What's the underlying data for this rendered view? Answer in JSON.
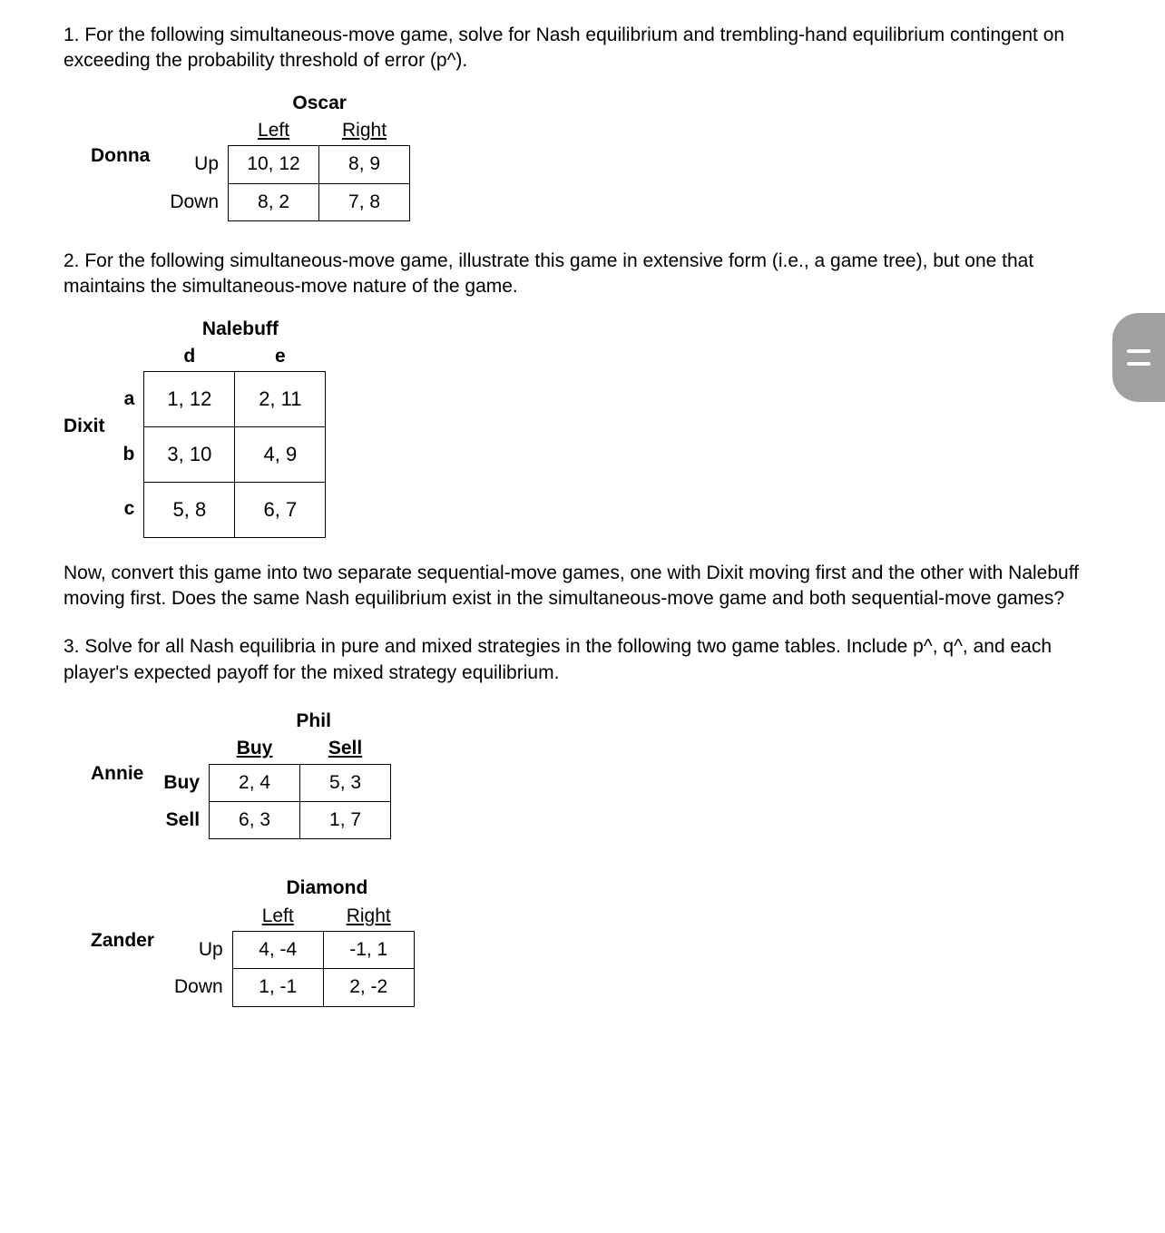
{
  "q1": {
    "text": "1. For the following simultaneous-move game, solve for Nash equilibrium and trembling-hand equilibrium contingent on exceeding the probability threshold of error (p^).",
    "game": {
      "rowPlayer": "Donna",
      "colPlayer": "Oscar",
      "rowLabels": [
        "Up",
        "Down"
      ],
      "colLabels": [
        "Left",
        "Right"
      ],
      "cells": [
        [
          "10, 12",
          "8, 9"
        ],
        [
          "8, 2",
          "7, 8"
        ]
      ]
    }
  },
  "q2": {
    "text": "2. For the following simultaneous-move game, illustrate this game in extensive form (i.e., a game tree), but one that maintains the simultaneous-move nature of the game.",
    "game": {
      "rowPlayer": "Dixit",
      "colPlayer": "Nalebuff",
      "rowLabels": [
        "a",
        "b",
        "c"
      ],
      "colLabels": [
        "d",
        "e"
      ],
      "cells": [
        [
          "1, 12",
          "2, 11"
        ],
        [
          "3, 10",
          "4, 9"
        ],
        [
          "5, 8",
          "6, 7"
        ]
      ]
    },
    "followup": "Now, convert this game into two separate sequential-move games, one with Dixit moving first and the other with Nalebuff moving first. Does the same Nash equilibrium exist in the simultaneous-move game and both sequential-move games?"
  },
  "q3": {
    "text": "3. Solve for all Nash equilibria in pure and mixed strategies in the following two game tables. Include p^, q^, and each player's expected payoff for the mixed strategy equilibrium.",
    "gameA": {
      "rowPlayer": "Annie",
      "colPlayer": "Phil",
      "rowLabels": [
        "Buy",
        "Sell"
      ],
      "colLabels": [
        "Buy",
        "Sell"
      ],
      "cells": [
        [
          "2, 4",
          "5, 3"
        ],
        [
          "6, 3",
          "1, 7"
        ]
      ]
    },
    "gameB": {
      "rowPlayer": "Zander",
      "colPlayer": "Diamond",
      "rowLabels": [
        "Up",
        "Down"
      ],
      "colLabels": [
        "Left",
        "Right"
      ],
      "cells": [
        [
          "4, -4",
          "-1, 1"
        ],
        [
          "1, -1",
          "2, -2"
        ]
      ]
    }
  },
  "chart_data": [
    {
      "type": "table",
      "title": "Donna vs Oscar payoff matrix",
      "rowPlayer": "Donna",
      "colPlayer": "Oscar",
      "rows": [
        "Up",
        "Down"
      ],
      "cols": [
        "Left",
        "Right"
      ],
      "payoffs": [
        [
          [
            10,
            12
          ],
          [
            8,
            9
          ]
        ],
        [
          [
            8,
            2
          ],
          [
            7,
            8
          ]
        ]
      ]
    },
    {
      "type": "table",
      "title": "Dixit vs Nalebuff payoff matrix",
      "rowPlayer": "Dixit",
      "colPlayer": "Nalebuff",
      "rows": [
        "a",
        "b",
        "c"
      ],
      "cols": [
        "d",
        "e"
      ],
      "payoffs": [
        [
          [
            1,
            12
          ],
          [
            2,
            11
          ]
        ],
        [
          [
            3,
            10
          ],
          [
            4,
            9
          ]
        ],
        [
          [
            5,
            8
          ],
          [
            6,
            7
          ]
        ]
      ]
    },
    {
      "type": "table",
      "title": "Annie vs Phil payoff matrix",
      "rowPlayer": "Annie",
      "colPlayer": "Phil",
      "rows": [
        "Buy",
        "Sell"
      ],
      "cols": [
        "Buy",
        "Sell"
      ],
      "payoffs": [
        [
          [
            2,
            4
          ],
          [
            5,
            3
          ]
        ],
        [
          [
            6,
            3
          ],
          [
            1,
            7
          ]
        ]
      ]
    },
    {
      "type": "table",
      "title": "Zander vs Diamond payoff matrix",
      "rowPlayer": "Zander",
      "colPlayer": "Diamond",
      "rows": [
        "Up",
        "Down"
      ],
      "cols": [
        "Left",
        "Right"
      ],
      "payoffs": [
        [
          [
            4,
            -4
          ],
          [
            -1,
            1
          ]
        ],
        [
          [
            1,
            -1
          ],
          [
            2,
            -2
          ]
        ]
      ]
    }
  ]
}
